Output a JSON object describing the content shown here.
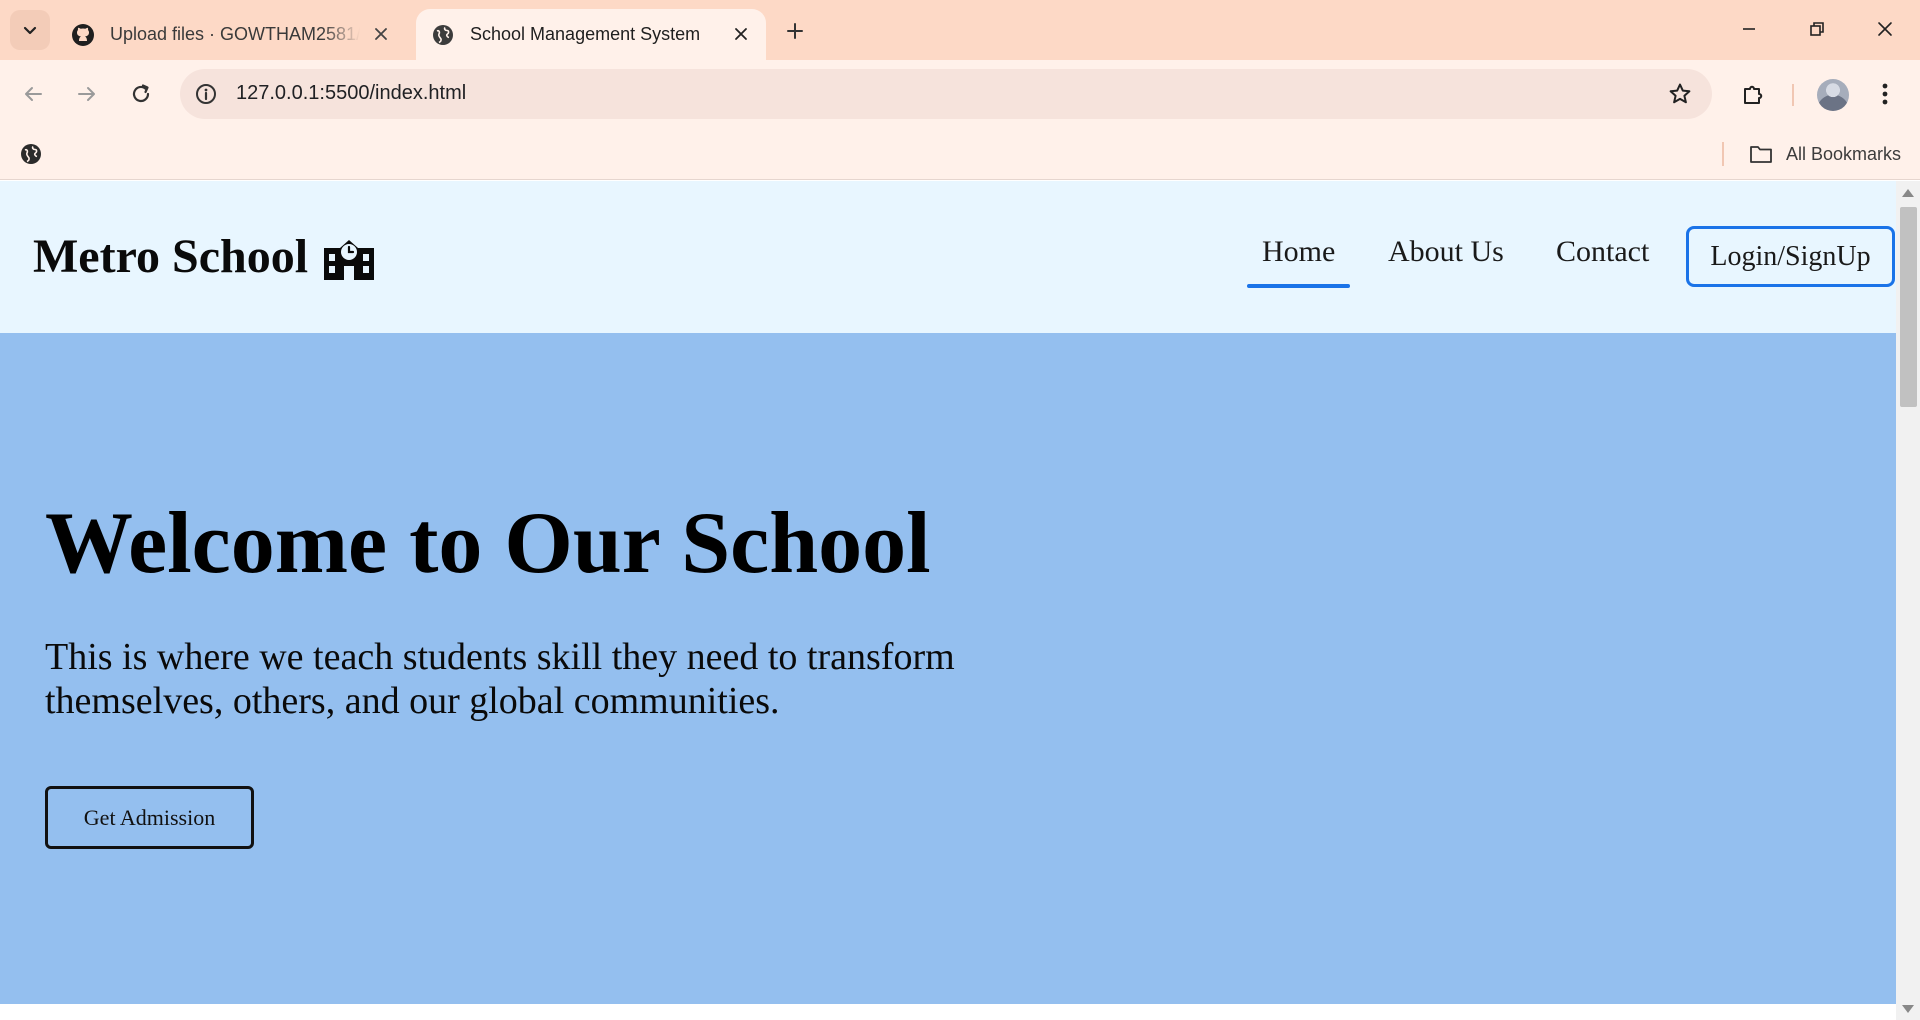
{
  "browser": {
    "tabs": [
      {
        "title": "Upload files · GOWTHAM2581/",
        "favicon": "github-icon",
        "active": false
      },
      {
        "title": "School Management System",
        "favicon": "globe-icon",
        "active": true
      }
    ],
    "address": {
      "url": "127.0.0.1:5500/index.html"
    },
    "bookmarks": {
      "all_bookmarks_label": "All Bookmarks"
    },
    "colors": {
      "tabstrip": "#fdd9c6",
      "toolbar": "#fff1ea",
      "omnibox": "#f6e3dc"
    }
  },
  "site": {
    "logo": {
      "text": "Metro School",
      "icon": "school-icon"
    },
    "nav": {
      "home": "Home",
      "about": "About Us",
      "contact": "Contact",
      "active": "Home",
      "login": "Login/SignUp"
    },
    "hero": {
      "title": "Welcome to Our School",
      "text": "This is where we teach students skill they need to transform themselves, others, and our global communities.",
      "button": "Get Admission"
    },
    "colors": {
      "header_bg": "#e8f6ff",
      "hero_bg": "#94bfef",
      "accent": "#1a73e8"
    }
  }
}
